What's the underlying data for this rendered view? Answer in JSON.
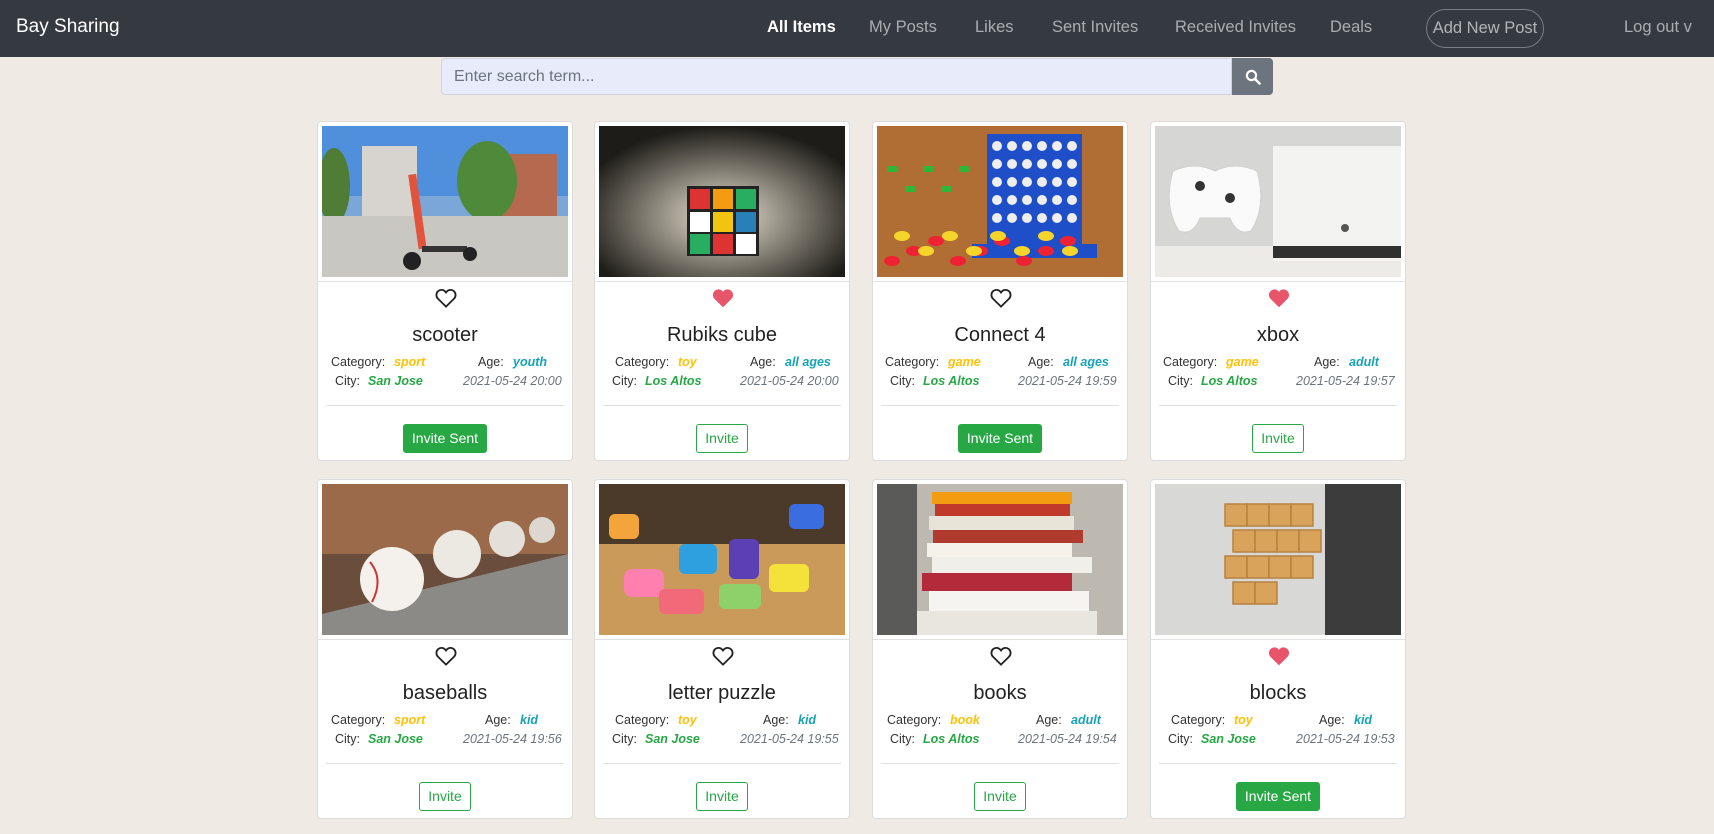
{
  "navbar": {
    "brand": "Bay Sharing",
    "links": [
      "All Items",
      "My Posts",
      "Likes",
      "Sent Invites",
      "Received Invites",
      "Deals"
    ],
    "active": "All Items",
    "add_post": "Add New Post",
    "logout": "Log out v"
  },
  "search": {
    "placeholder": "Enter search term...",
    "value": "",
    "icon": "search-icon"
  },
  "labels": {
    "category": "Category:",
    "age": "Age:",
    "city": "City:"
  },
  "colors": {
    "category": "#ffc107",
    "age": "#17a2b8",
    "city": "#28a745",
    "liked_heart": "#e8546a",
    "button_green": "#28a745"
  },
  "items": [
    {
      "title": "scooter",
      "liked": false,
      "category": "sport",
      "age": "youth",
      "city": "San Jose",
      "date": "2021-05-24 20:00",
      "button": "Invite Sent",
      "sent": true
    },
    {
      "title": "Rubiks cube",
      "liked": true,
      "category": "toy",
      "age": "all ages",
      "city": "Los Altos",
      "date": "2021-05-24 20:00",
      "button": "Invite",
      "sent": false
    },
    {
      "title": "Connect 4",
      "liked": false,
      "category": "game",
      "age": "all ages",
      "city": "Los Altos",
      "date": "2021-05-24 19:59",
      "button": "Invite Sent",
      "sent": true
    },
    {
      "title": "xbox",
      "liked": true,
      "category": "game",
      "age": "adult",
      "city": "Los Altos",
      "date": "2021-05-24 19:57",
      "button": "Invite",
      "sent": false
    },
    {
      "title": "baseballs",
      "liked": false,
      "category": "sport",
      "age": "kid",
      "city": "San Jose",
      "date": "2021-05-24 19:56",
      "button": "Invite",
      "sent": false
    },
    {
      "title": "letter puzzle",
      "liked": false,
      "category": "toy",
      "age": "kid",
      "city": "San Jose",
      "date": "2021-05-24 19:55",
      "button": "Invite",
      "sent": false
    },
    {
      "title": "books",
      "liked": false,
      "category": "book",
      "age": "adult",
      "city": "Los Altos",
      "date": "2021-05-24 19:54",
      "button": "Invite",
      "sent": false
    },
    {
      "title": "blocks",
      "liked": true,
      "category": "toy",
      "age": "kid",
      "city": "San Jose",
      "date": "2021-05-24 19:53",
      "button": "Invite Sent",
      "sent": true
    }
  ]
}
